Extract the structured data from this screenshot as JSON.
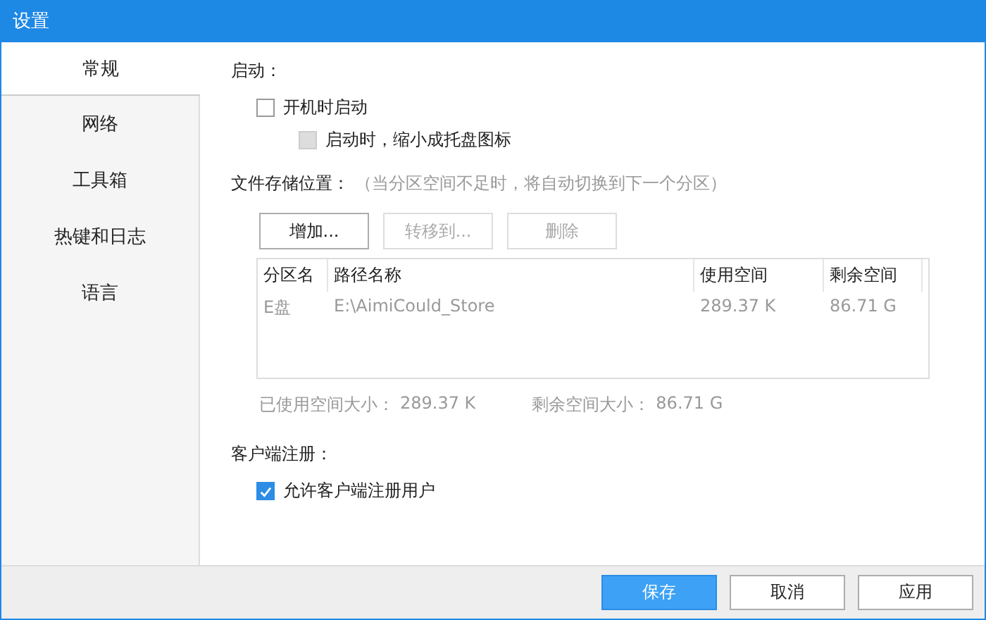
{
  "window": {
    "title": "设置"
  },
  "sidebar": {
    "items": [
      {
        "label": "常规",
        "selected": true
      },
      {
        "label": "网络",
        "selected": false
      },
      {
        "label": "工具箱",
        "selected": false
      },
      {
        "label": "热键和日志",
        "selected": false
      },
      {
        "label": "语言",
        "selected": false
      }
    ]
  },
  "startup": {
    "heading": "启动：",
    "options": [
      {
        "label": "开机时启动",
        "checked": false,
        "disabled": false,
        "children": [
          {
            "label": "启动时，缩小成托盘图标",
            "checked": false,
            "disabled": true
          }
        ]
      }
    ]
  },
  "storage": {
    "heading": "文件存储位置：",
    "hint": "（当分区空间不足时，将自动切换到下一个分区）",
    "buttons": [
      {
        "label": "增加...",
        "disabled": false
      },
      {
        "label": "转移到...",
        "disabled": true
      },
      {
        "label": "删除",
        "disabled": true
      }
    ],
    "table": {
      "columns": [
        "分区名",
        "路径名称",
        "使用空间",
        "剩余空间"
      ],
      "rows": [
        [
          "E盘",
          "E:\\AimiCould_Store",
          "289.37 K",
          "86.71 G"
        ]
      ]
    },
    "used_label": "已使用空间大小：",
    "used_value": "289.37 K",
    "free_label": "剩余空间大小：",
    "free_value": "86.71 G"
  },
  "registration": {
    "heading": "客户端注册：",
    "options": [
      {
        "label": "允许客户端注册用户",
        "checked": true
      }
    ]
  },
  "footer": {
    "buttons": [
      {
        "label": "保存",
        "primary": true
      },
      {
        "label": "取消",
        "primary": false
      },
      {
        "label": "应用",
        "primary": false
      }
    ]
  }
}
